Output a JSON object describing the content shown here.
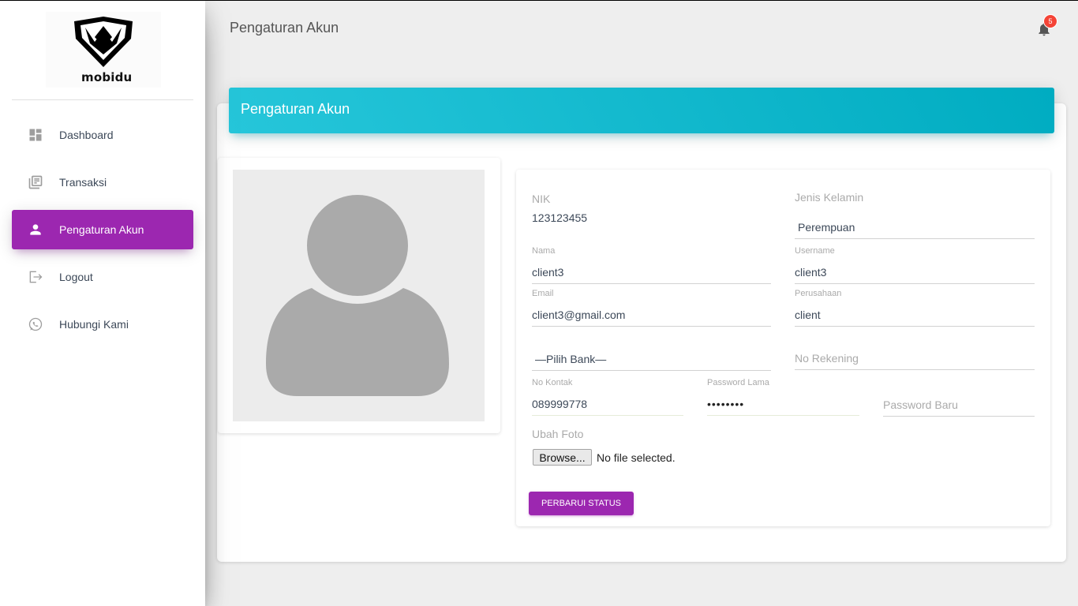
{
  "brand": {
    "name": "mobidu"
  },
  "sidebar": {
    "items": [
      {
        "label": "Dashboard",
        "icon": "dashboard-icon",
        "active": false
      },
      {
        "label": "Transaksi",
        "icon": "library-books-icon",
        "active": false
      },
      {
        "label": "Pengaturan Akun",
        "icon": "person-icon",
        "active": true
      },
      {
        "label": "Logout",
        "icon": "logout-icon",
        "active": false
      },
      {
        "label": "Hubungi Kami",
        "icon": "whatsapp-icon",
        "active": false
      }
    ]
  },
  "topbar": {
    "title": "Pengaturan Akun",
    "notification_count": "5"
  },
  "card": {
    "title": "Pengaturan Akun"
  },
  "profile": {
    "nik_label": "NIK",
    "nik_value": "123123455",
    "gender_label": "Jenis Kelamin",
    "gender_value": "Perempuan",
    "name_label": "Nama",
    "name_value": "client3",
    "username_label": "Username",
    "username_value": "client3",
    "email_label": "Email",
    "email_value": "client3@gmail.com",
    "company_label": "Perusahaan",
    "company_value": "client",
    "bank_value": "—Pilih Bank—",
    "account_placeholder": "No Rekening",
    "contact_label": "No Kontak",
    "contact_value": "089999778",
    "old_password_label": "Password Lama",
    "old_password_value": "••••••••",
    "new_password_placeholder": "Password Baru",
    "photo_label": "Ubah Foto",
    "browse_label": "Browse...",
    "no_file_text": "No file selected.",
    "submit_label": "PERBARUI STATUS"
  },
  "colors": {
    "accent": "#9c27b0",
    "header_cyan": "#00acc1",
    "badge": "#f44336"
  }
}
